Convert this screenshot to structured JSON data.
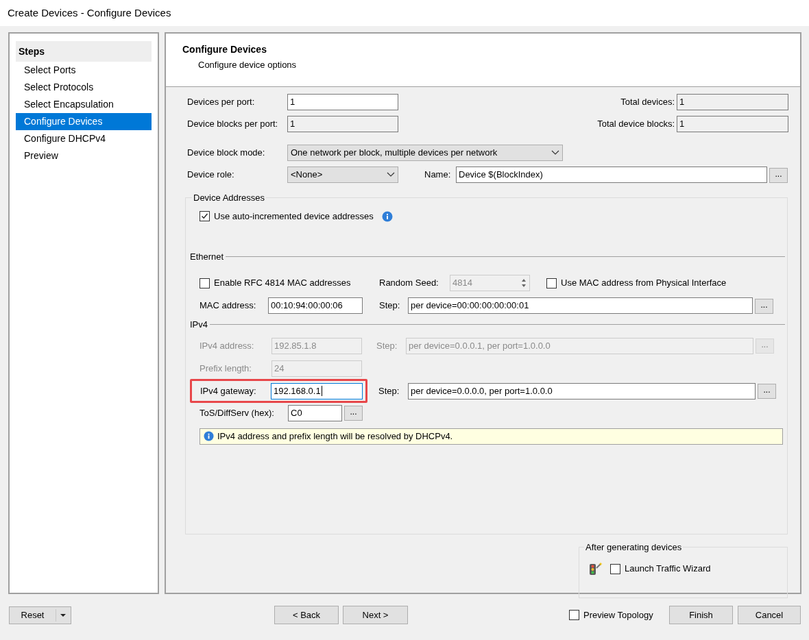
{
  "window": {
    "title": "Create Devices - Configure Devices"
  },
  "steps": {
    "heading": "Steps",
    "items": [
      {
        "label": "Select Ports",
        "selected": false
      },
      {
        "label": "Select Protocols",
        "selected": false
      },
      {
        "label": "Select Encapsulation",
        "selected": false
      },
      {
        "label": "Configure Devices",
        "selected": true
      },
      {
        "label": "Configure DHCPv4",
        "selected": false
      },
      {
        "label": "Preview",
        "selected": false
      }
    ]
  },
  "header": {
    "title": "Configure Devices",
    "subtitle": "Configure device options"
  },
  "devices_per_port": {
    "label": "Devices per port:",
    "value": "1",
    "readonly": false
  },
  "device_blocks_per_port": {
    "label": "Device blocks per port:",
    "value": "1",
    "readonly": true
  },
  "total_devices": {
    "label": "Total devices:",
    "value": "1",
    "readonly": true
  },
  "total_device_blocks": {
    "label": "Total device blocks:",
    "value": "1",
    "readonly": true
  },
  "device_block_mode": {
    "label": "Device block mode:",
    "value": "One network per block, multiple devices per network"
  },
  "device_role": {
    "label": "Device role:",
    "value": "<None>"
  },
  "name": {
    "label": "Name:",
    "value": "Device $(BlockIndex)",
    "button": "..."
  },
  "device_addresses": {
    "legend": "Device Addresses",
    "auto_increment": {
      "label": "Use auto-incremented device addresses",
      "checked": true
    },
    "ethernet": {
      "heading": "Ethernet",
      "enable_rfc": {
        "label": "Enable RFC 4814 MAC addresses",
        "checked": false
      },
      "random_seed": {
        "label": "Random Seed:",
        "value": "4814",
        "disabled": true
      },
      "use_phys_mac": {
        "label": "Use MAC address from Physical Interface",
        "checked": false
      },
      "mac_address": {
        "label": "MAC address:",
        "value": "00:10:94:00:00:06",
        "disabled": false
      },
      "mac_step": {
        "label": "Step:",
        "value": "per device=00:00:00:00:00:01",
        "button": "...",
        "disabled": false
      }
    },
    "ipv4": {
      "heading": "IPv4",
      "address": {
        "label": "IPv4 address:",
        "value": "192.85.1.8",
        "disabled": true
      },
      "address_step": {
        "label": "Step:",
        "value": "per device=0.0.0.1, per port=1.0.0.0",
        "button": "...",
        "disabled": true
      },
      "prefix_length": {
        "label": "Prefix length:",
        "value": "24",
        "disabled": true
      },
      "gateway": {
        "label": "IPv4 gateway:",
        "value": "192.168.0.1",
        "disabled": false,
        "focused": true,
        "highlighted": true
      },
      "gateway_step": {
        "label": "Step:",
        "value": "per device=0.0.0.0, per port=1.0.0.0",
        "button": "...",
        "disabled": false
      },
      "tos": {
        "label": "ToS/DiffServ (hex):",
        "value": "C0",
        "button": "...",
        "disabled": false
      },
      "info": "IPv4 address and prefix length will be resolved by DHCPv4."
    }
  },
  "after_generating": {
    "legend": "After generating devices",
    "launch_traffic_wizard": {
      "label": "Launch Traffic Wizard",
      "checked": false
    }
  },
  "footer": {
    "reset": "Reset",
    "back": "< Back",
    "next": "Next >",
    "preview_topology": {
      "label": "Preview Topology",
      "checked": false
    },
    "finish": "Finish",
    "cancel": "Cancel"
  }
}
